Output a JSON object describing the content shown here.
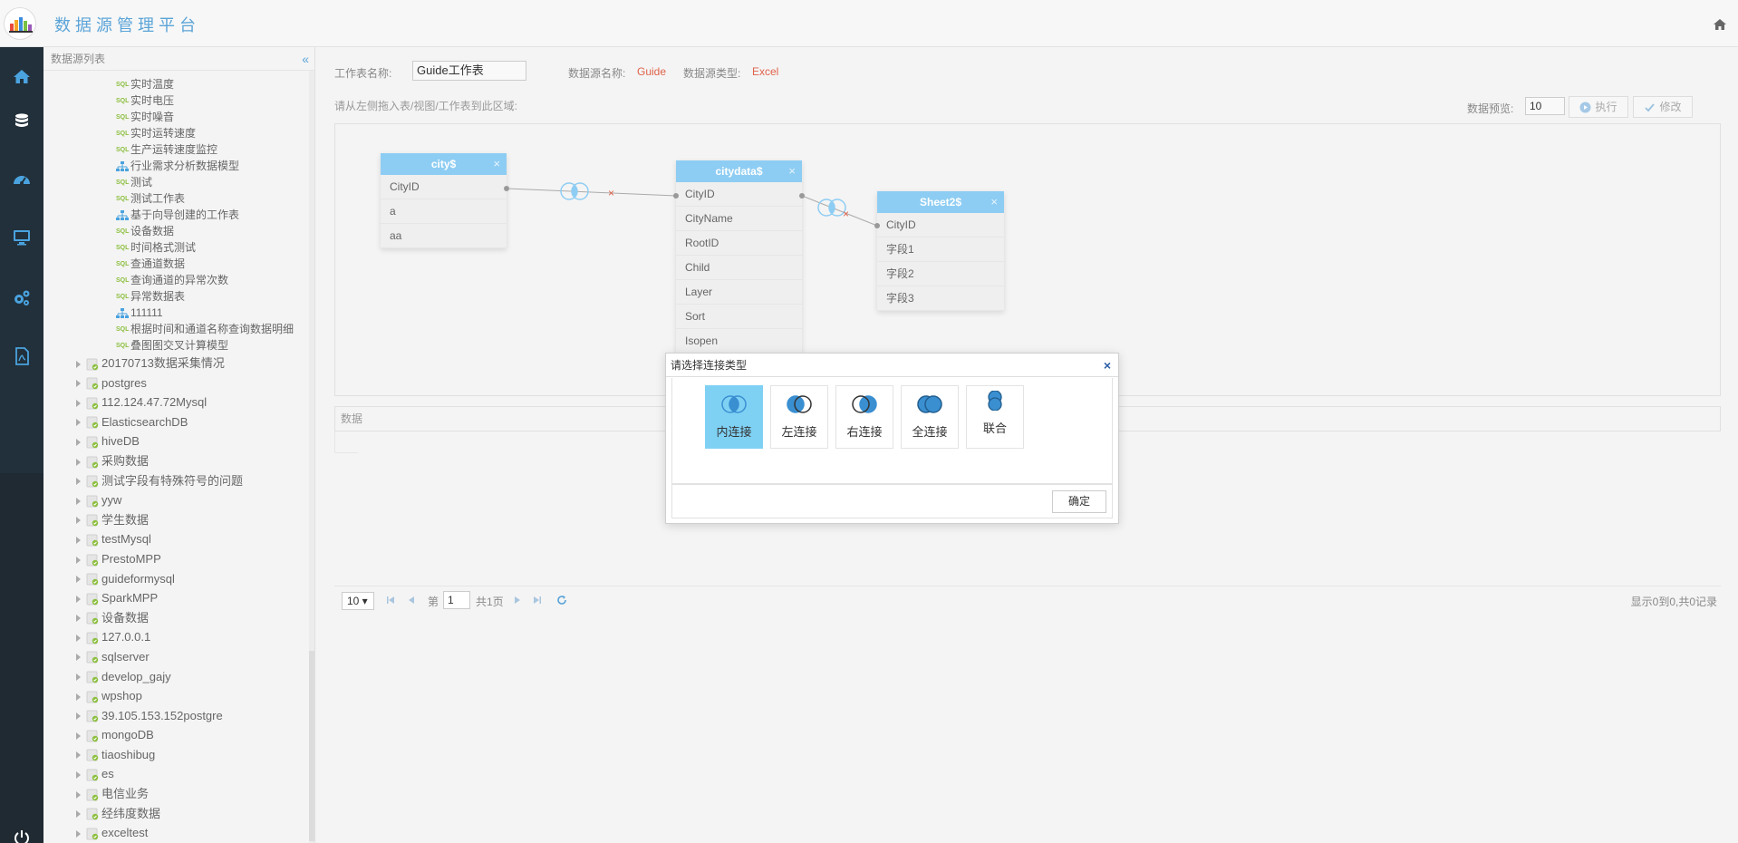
{
  "header": {
    "title": "数据源管理平台"
  },
  "tree": {
    "title": "数据源列表",
    "collapse_glyph": "«",
    "children": [
      {
        "type": "sql",
        "label": "实时温度"
      },
      {
        "type": "sql",
        "label": "实时电压"
      },
      {
        "type": "sql",
        "label": "实时噪音"
      },
      {
        "type": "sql",
        "label": "实时运转速度"
      },
      {
        "type": "sql",
        "label": "生产运转速度监控"
      },
      {
        "type": "model",
        "label": "行业需求分析数据模型"
      },
      {
        "type": "sql",
        "label": "测试"
      },
      {
        "type": "sql",
        "label": "测试工作表"
      },
      {
        "type": "model",
        "label": "基于向导创建的工作表"
      },
      {
        "type": "sql",
        "label": "设备数据"
      },
      {
        "type": "sql",
        "label": "时间格式测试"
      },
      {
        "type": "sql",
        "label": "查通道数据"
      },
      {
        "type": "sql",
        "label": "查询通道的异常次数"
      },
      {
        "type": "sql",
        "label": "异常数据表"
      },
      {
        "type": "model",
        "label": "111111"
      },
      {
        "type": "sql",
        "label": "根据时间和通道名称查询数据明细"
      },
      {
        "type": "sql",
        "label": "叠图图交叉计算模型"
      }
    ],
    "sql_badge": "SQL",
    "databases": [
      "20170713数据采集情况",
      "postgres",
      "112.124.47.72Mysql",
      "ElasticsearchDB",
      "hiveDB",
      "采购数据",
      "测试字段有特殊符号的问题",
      "yyw",
      "学生数据",
      "testMysql",
      "PrestoMPP",
      "guideformysql",
      "SparkMPP",
      "设备数据",
      "127.0.0.1",
      "sqlserver",
      "develop_gajy",
      "wpshop",
      "39.105.153.152postgre",
      "mongoDB",
      "tiaoshibug",
      "es",
      "电信业务",
      "经纬度数据",
      "exceltest"
    ]
  },
  "form": {
    "sheet_name_label": "工作表名称:",
    "sheet_name_value": "Guide工作表",
    "source_name_label": "数据源名称:",
    "source_name_value": "Guide",
    "source_type_label": "数据源类型:",
    "source_type_value": "Excel",
    "hint": "请从左侧拖入表/视图/工作表到此区域:",
    "preview_label": "数据预览:",
    "preview_value": "10",
    "execute_label": "执行",
    "modify_label": "修改"
  },
  "tables": {
    "city": {
      "title": "city$",
      "close": "×",
      "fields": [
        "CityID",
        "a",
        "aa"
      ]
    },
    "citydata": {
      "title": "citydata$",
      "close": "×",
      "fields": [
        "CityID",
        "CityName",
        "RootID",
        "Child",
        "Layer",
        "Sort",
        "Isopen"
      ]
    },
    "sheet2": {
      "title": "Sheet2$",
      "close": "×",
      "fields": [
        "CityID",
        "字段1",
        "字段2",
        "字段3"
      ]
    }
  },
  "data_section": {
    "label": "数据"
  },
  "pager": {
    "page_size": "10 ▾",
    "page_prefix": "第",
    "page_value": "1",
    "page_suffix": "共1页",
    "info": "显示0到0,共0记录"
  },
  "dialog": {
    "title": "请选择连接类型",
    "close": "×",
    "options": [
      {
        "label": "内连接",
        "active": true
      },
      {
        "label": "左连接",
        "active": false
      },
      {
        "label": "右连接",
        "active": false
      },
      {
        "label": "全连接",
        "active": false
      },
      {
        "label": "联合",
        "active": false
      }
    ],
    "ok_label": "确定"
  },
  "colors": {
    "accent": "#5ba4d8",
    "table_header": "#8ecdf3",
    "active_join": "#7fd1f4",
    "highlight": "#e0624a",
    "rail": "#1f2a33"
  }
}
